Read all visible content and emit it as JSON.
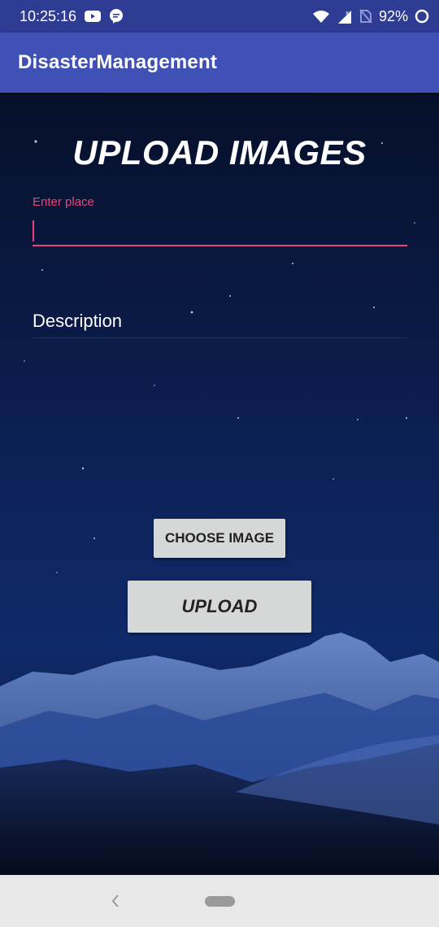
{
  "status_bar": {
    "time": "10:25:16",
    "battery": "92%",
    "icons": [
      "youtube-icon",
      "chat-bubble-icon",
      "wifi-icon",
      "cell-signal-icon",
      "no-sim-icon",
      "battery-ring-icon"
    ]
  },
  "app_bar": {
    "title": "DisasterManagement"
  },
  "main": {
    "heading": "UPLOAD IMAGES",
    "place_field": {
      "label": "Enter place",
      "value": ""
    },
    "description_field": {
      "placeholder": "Description"
    },
    "choose_image_label": "CHOOSE IMAGE",
    "upload_label": "UPLOAD"
  },
  "nav_bar": {
    "icons": [
      "back-icon",
      "home-pill-icon"
    ]
  },
  "colors": {
    "status_bar": "#2f3c94",
    "app_bar": "#3f51b5",
    "accent": "#e5457a",
    "button": "#d6d7d7"
  }
}
